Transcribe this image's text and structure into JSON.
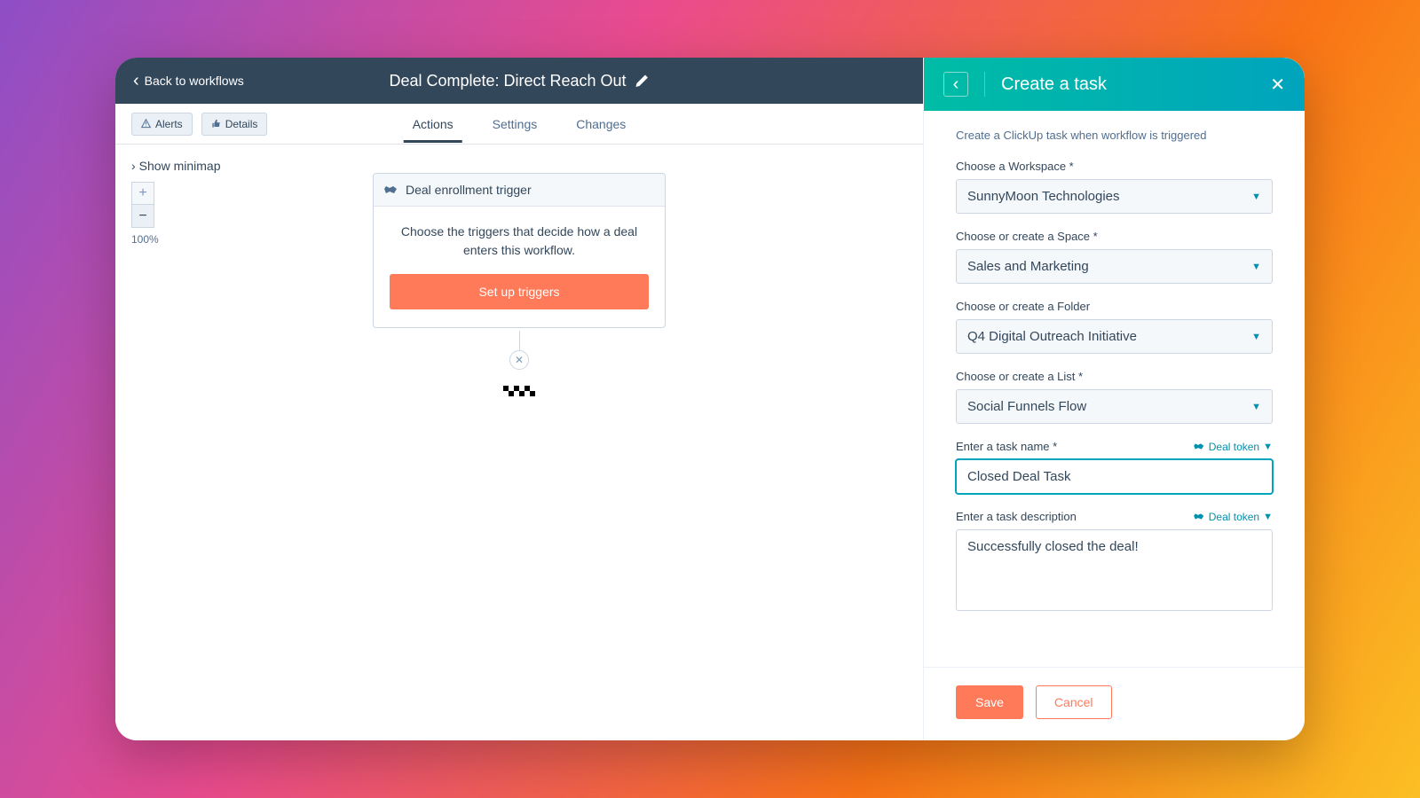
{
  "topbar": {
    "back_label": "Back to workflows",
    "title": "Deal Complete: Direct Reach Out"
  },
  "subbar": {
    "alerts_label": "Alerts",
    "details_label": "Details"
  },
  "tabs": {
    "actions": "Actions",
    "settings": "Settings",
    "changes": "Changes"
  },
  "canvas": {
    "minimap_label": "Show minimap",
    "zoom_level": "100%",
    "trigger_title": "Deal enrollment trigger",
    "trigger_desc": "Choose the triggers that decide how a deal enters this workflow.",
    "setup_btn": "Set up triggers"
  },
  "panel": {
    "title": "Create a task",
    "description": "Create a ClickUp task when workflow is triggered",
    "fields": {
      "workspace": {
        "label": "Choose a Workspace *",
        "value": "SunnyMoon Technologies"
      },
      "space": {
        "label": "Choose or create a Space *",
        "value": "Sales and Marketing"
      },
      "folder": {
        "label": "Choose or create a Folder",
        "value": "Q4 Digital Outreach Initiative"
      },
      "list": {
        "label": "Choose or create a List *",
        "value": "Social Funnels Flow"
      },
      "task_name": {
        "label": "Enter a task name *",
        "value": "Closed Deal Task"
      },
      "task_desc": {
        "label": "Enter a task description",
        "value": "Successfully closed the deal!"
      }
    },
    "deal_token_label": "Deal token",
    "save": "Save",
    "cancel": "Cancel"
  }
}
